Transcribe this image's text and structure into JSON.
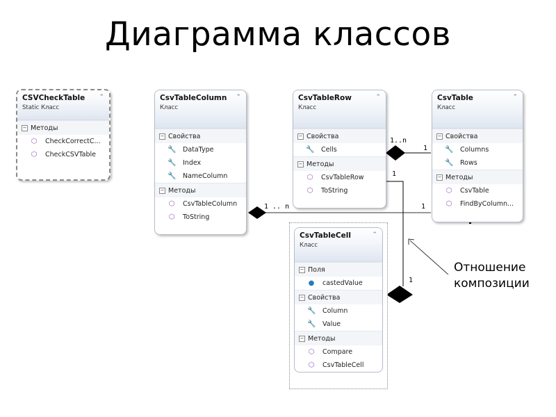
{
  "title": "Диаграмма классов",
  "annotation": [
    "Отношение",
    "композиции"
  ],
  "icons": {
    "collapse": "double-chevron-up-icon",
    "section": "minus-box-icon",
    "method": "method-cube-icon",
    "property": "wrench-icon",
    "field": "field-icon"
  },
  "classes": {
    "csvCheckTable": {
      "name": "CSVCheckTable",
      "kind": "Static Класс",
      "methods_label": "Методы",
      "methods": [
        "CheckCorrectC...",
        "CheckCSVTable"
      ]
    },
    "csvTableColumn": {
      "name": "CsvTableColumn",
      "kind": "Класс",
      "props_label": "Свойства",
      "props": [
        "DataType",
        "Index",
        "NameColumn"
      ],
      "methods_label": "Методы",
      "methods": [
        "CsvTableColumn",
        "ToString"
      ]
    },
    "csvTableRow": {
      "name": "CsvTableRow",
      "kind": "Класс",
      "props_label": "Свойства",
      "props": [
        "Cells"
      ],
      "methods_label": "Методы",
      "methods": [
        "CsvTableRow",
        "ToString"
      ]
    },
    "csvTable": {
      "name": "CsvTable",
      "kind": "Класс",
      "props_label": "Свойства",
      "props": [
        "Columns",
        "Rows"
      ],
      "methods_label": "Методы",
      "methods": [
        "CsvTable",
        "FindByColumn..."
      ]
    },
    "csvTableCell": {
      "name": "CsvTableCell",
      "kind": "Класс",
      "fields_label": "Поля",
      "fields": [
        "castedValue"
      ],
      "props_label": "Свойства",
      "props": [
        "Column",
        "Value"
      ],
      "methods_label": "Методы",
      "methods": [
        "Compare",
        "CsvTableCell"
      ]
    }
  },
  "multiplicities": {
    "row_cells_many": "1..n",
    "table_rows_one": "1",
    "row_cell_one": "1",
    "cell_one": "1",
    "column_many": "1 .. n",
    "table_columns_one": "1"
  }
}
